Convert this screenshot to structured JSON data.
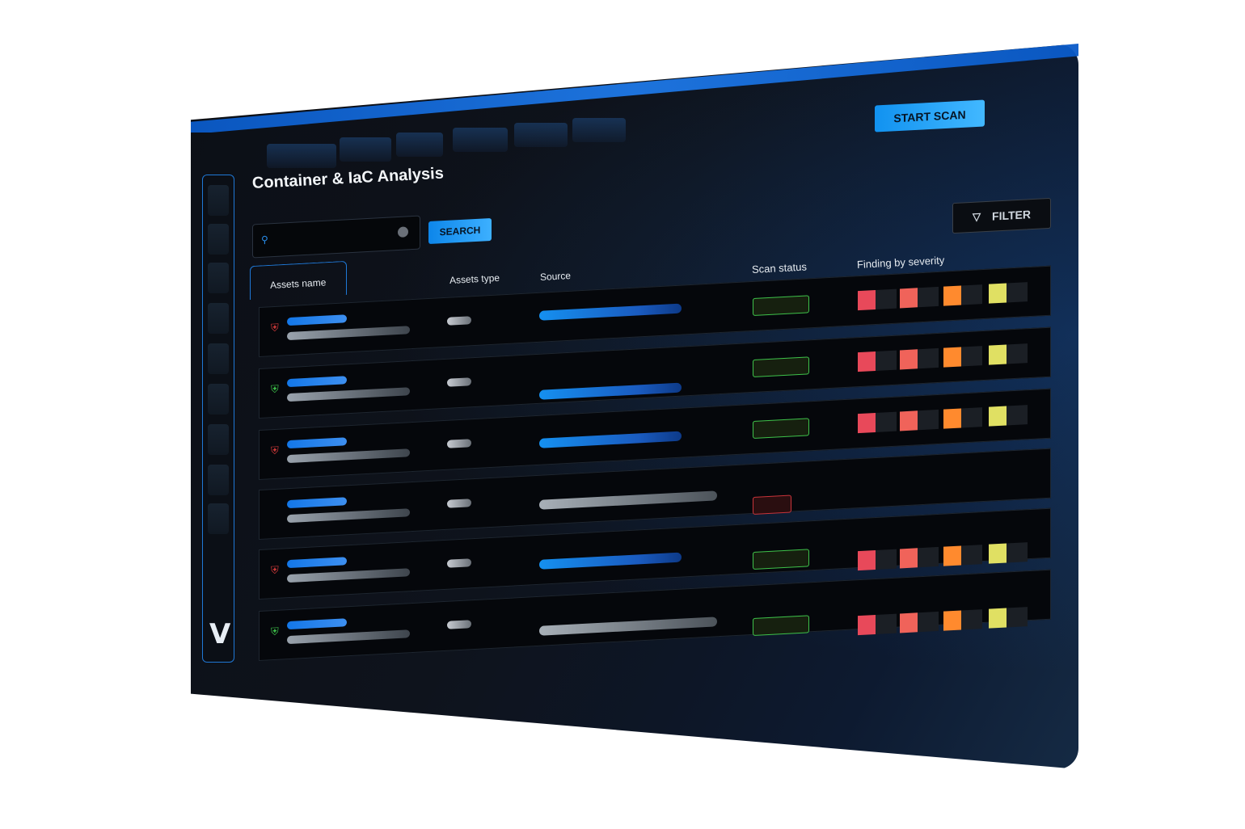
{
  "header": {
    "start_scan_label": "START SCAN"
  },
  "page": {
    "title": "Container & IaC Analysis"
  },
  "search": {
    "button_label": "SEARCH",
    "placeholder": ""
  },
  "filter": {
    "label": "FILTER"
  },
  "table": {
    "headers": {
      "assets_name": "Assets name",
      "assets_type": "Assets type",
      "source": "Source",
      "scan_status": "Scan status",
      "finding_by_severity": "Finding by severity"
    }
  },
  "sidebar": {
    "logo": "V"
  },
  "colors": {
    "accent": "#1f78d6",
    "critical": "#e8495a",
    "high": "#f0635a",
    "medium": "#ff8a2e",
    "low": "#e0e063",
    "ok": "#3ec24a",
    "error": "#c9343a"
  },
  "icons": {
    "risk_shield": "shield-risk-icon",
    "safe_shield": "shield-check-icon",
    "search": "search-icon",
    "filter": "filter-icon"
  }
}
